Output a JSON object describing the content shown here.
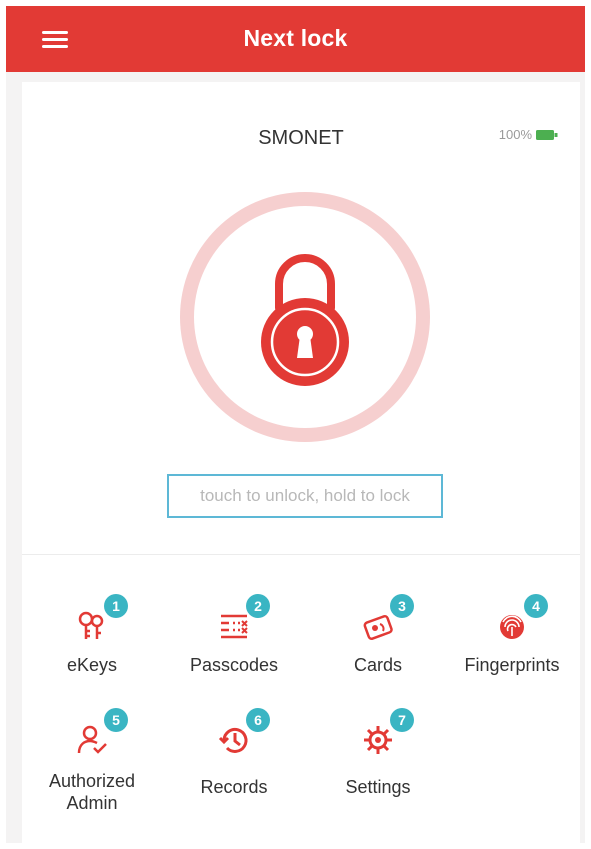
{
  "appbar": {
    "title": "Next lock"
  },
  "device": {
    "name": "SMONET",
    "battery": "100%"
  },
  "lock": {
    "hint": "touch to unlock, hold to lock"
  },
  "features": [
    {
      "label": "eKeys",
      "badge": "1",
      "icon": "key-icon"
    },
    {
      "label": "Passcodes",
      "badge": "2",
      "icon": "passcode-list-icon"
    },
    {
      "label": "Cards",
      "badge": "3",
      "icon": "card-icon"
    },
    {
      "label": "Fingerprints",
      "badge": "4",
      "icon": "fingerprint-icon"
    },
    {
      "label": "Authorized\nAdmin",
      "badge": "5",
      "icon": "admin-user-icon"
    },
    {
      "label": "Records",
      "badge": "6",
      "icon": "history-icon"
    },
    {
      "label": "Settings",
      "badge": "7",
      "icon": "gear-icon"
    }
  ],
  "colors": {
    "brand": "#e23a35",
    "badge": "#3ab5c3",
    "battery": "#4caf50"
  }
}
